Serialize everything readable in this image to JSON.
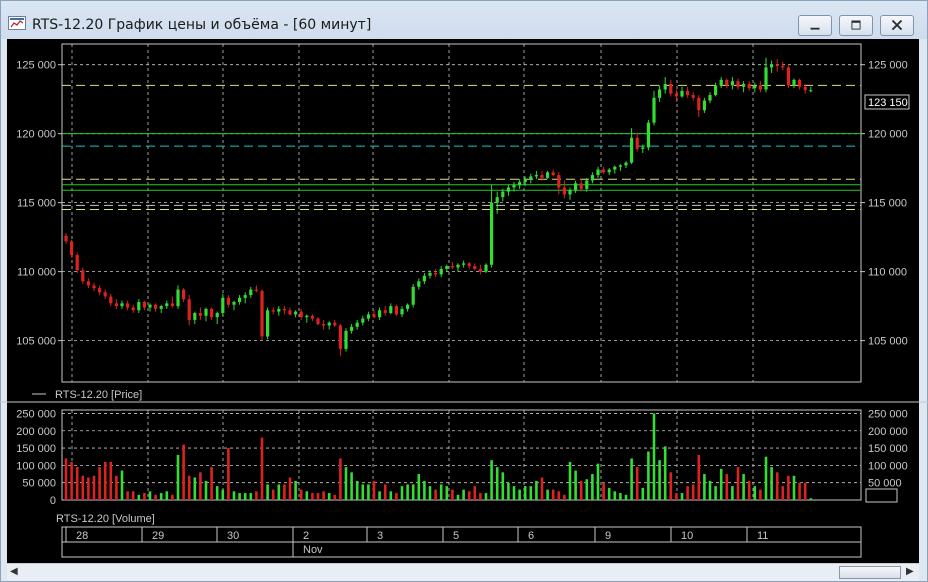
{
  "window": {
    "title": "RTS-12.20 График цены и объёма - [60 минут]",
    "buttons": [
      "minimize",
      "maximize",
      "close"
    ],
    "icon": "chart-window-icon"
  },
  "colors": {
    "background": "#000000",
    "up": "#33dd33",
    "down": "#dd2222",
    "grid": "#c8c8c8",
    "level_green": "#22cc22",
    "level_cyan": "#11c8c8",
    "level_yellow": "#e0e080",
    "level_white": "#c8c8c8",
    "price_label_bg": "#000000"
  },
  "price_panel": {
    "legend": "RTS-12.20 [Price]",
    "y_ticks": [
      "125 000",
      "120 000",
      "115 000",
      "110 000",
      "105 000"
    ],
    "current_price_label": "123 150"
  },
  "volume_panel": {
    "legend": "RTS-12.20 [Volume]",
    "y_ticks": [
      "250 000",
      "200 000",
      "150 000",
      "100 000",
      "50 000",
      "0"
    ]
  },
  "date_axis": {
    "days": [
      "28",
      "29",
      "30",
      "2",
      "3",
      "5",
      "6",
      "9",
      "10",
      "11"
    ],
    "month_label": "Nov"
  },
  "chart_data": {
    "type": "candlestick",
    "symbol": "RTS-12.20",
    "timeframe": "60 минут",
    "ylim_price": [
      102000,
      126500
    ],
    "ylim_volume": [
      0,
      260000
    ],
    "horizontal_levels": [
      {
        "price": 123500,
        "style": "dashed",
        "color": "yellow"
      },
      {
        "price": 120000,
        "style": "solid",
        "color": "green"
      },
      {
        "price": 119100,
        "style": "dashed",
        "color": "cyan"
      },
      {
        "price": 116700,
        "style": "dashed",
        "color": "yellow"
      },
      {
        "price": 116300,
        "style": "solid",
        "color": "green"
      },
      {
        "price": 115900,
        "style": "solid",
        "color": "green"
      },
      {
        "price": 114800,
        "style": "dashed",
        "color": "white"
      },
      {
        "price": 114500,
        "style": "dashed",
        "color": "yellow"
      }
    ],
    "candles": [
      [
        112600,
        112800,
        112000,
        112200
      ],
      [
        112200,
        112300,
        111000,
        111200
      ],
      [
        111200,
        111400,
        109900,
        110100
      ],
      [
        110100,
        110300,
        109100,
        109300
      ],
      [
        109300,
        109500,
        108800,
        109000
      ],
      [
        109000,
        109200,
        108600,
        108800
      ],
      [
        108800,
        109000,
        108300,
        108500
      ],
      [
        108500,
        108700,
        108000,
        108200
      ],
      [
        108200,
        108400,
        107500,
        107700
      ],
      [
        107700,
        108000,
        107300,
        107500
      ],
      [
        107500,
        107900,
        107300,
        107700
      ],
      [
        107700,
        107900,
        107200,
        107400
      ],
      [
        107400,
        107600,
        107000,
        107200
      ],
      [
        107200,
        108000,
        107000,
        107800
      ],
      [
        107800,
        107900,
        107200,
        107400
      ],
      [
        107400,
        107700,
        107100,
        107600
      ],
      [
        107600,
        107700,
        107100,
        107300
      ],
      [
        107300,
        107600,
        107000,
        107500
      ],
      [
        107500,
        107900,
        107300,
        107700
      ],
      [
        107700,
        108200,
        107400,
        107500
      ],
      [
        107500,
        109000,
        107300,
        108700
      ],
      [
        108700,
        108800,
        107800,
        108000
      ],
      [
        108000,
        108300,
        106100,
        106500
      ],
      [
        106500,
        107100,
        106200,
        107000
      ],
      [
        107000,
        107400,
        106500,
        106800
      ],
      [
        106800,
        107400,
        106400,
        107300
      ],
      [
        107300,
        107400,
        106500,
        106700
      ],
      [
        106700,
        107100,
        106200,
        107000
      ],
      [
        107000,
        108400,
        106800,
        108100
      ],
      [
        108100,
        108300,
        107400,
        107600
      ],
      [
        107600,
        107900,
        107200,
        107800
      ],
      [
        107800,
        108300,
        107600,
        108100
      ],
      [
        108100,
        108500,
        107700,
        108300
      ],
      [
        108300,
        108900,
        108100,
        108700
      ],
      [
        108700,
        109000,
        108500,
        108600
      ],
      [
        108600,
        108700,
        105000,
        105300
      ],
      [
        105300,
        107400,
        105100,
        107200
      ],
      [
        107200,
        107400,
        106900,
        107100
      ],
      [
        107100,
        107500,
        106800,
        107300
      ],
      [
        107300,
        107500,
        106900,
        107200
      ],
      [
        107200,
        107400,
        106800,
        106900
      ],
      [
        106900,
        107200,
        106700,
        107100
      ],
      [
        107100,
        107300,
        106500,
        106700
      ],
      [
        106700,
        106900,
        106300,
        106800
      ],
      [
        106800,
        106900,
        106400,
        106600
      ],
      [
        106600,
        106700,
        106100,
        106200
      ],
      [
        106200,
        106500,
        105800,
        106100
      ],
      [
        106100,
        106400,
        105800,
        106300
      ],
      [
        106300,
        106500,
        106000,
        106100
      ],
      [
        106100,
        106200,
        103900,
        104400
      ],
      [
        104400,
        105900,
        104200,
        105700
      ],
      [
        105700,
        106200,
        105500,
        106000
      ],
      [
        106000,
        106500,
        105800,
        106300
      ],
      [
        106300,
        106800,
        106100,
        106600
      ],
      [
        106600,
        107100,
        106400,
        106900
      ],
      [
        106900,
        107200,
        106600,
        106700
      ],
      [
        106700,
        107400,
        106500,
        107200
      ],
      [
        107200,
        107500,
        106800,
        107000
      ],
      [
        107000,
        107700,
        106900,
        107500
      ],
      [
        107500,
        107600,
        106800,
        106900
      ],
      [
        106900,
        107500,
        106700,
        107300
      ],
      [
        107300,
        107700,
        107100,
        107600
      ],
      [
        107600,
        109100,
        107400,
        108900
      ],
      [
        108900,
        109500,
        108700,
        109300
      ],
      [
        109300,
        109900,
        109100,
        109700
      ],
      [
        109700,
        110100,
        109500,
        109900
      ],
      [
        109900,
        110200,
        109600,
        109800
      ],
      [
        109800,
        110400,
        109600,
        110200
      ],
      [
        110200,
        110500,
        110000,
        110400
      ],
      [
        110400,
        110700,
        110200,
        110300
      ],
      [
        110300,
        110600,
        110000,
        110500
      ],
      [
        110500,
        110800,
        110300,
        110600
      ],
      [
        110600,
        110700,
        110200,
        110400
      ],
      [
        110400,
        110600,
        110100,
        110200
      ],
      [
        110200,
        110500,
        109800,
        110000
      ],
      [
        110000,
        110600,
        109900,
        110500
      ],
      [
        110500,
        116300,
        110300,
        115000
      ],
      [
        115000,
        115800,
        114200,
        115400
      ],
      [
        115400,
        116000,
        115100,
        115800
      ],
      [
        115800,
        116300,
        115500,
        116100
      ],
      [
        116100,
        116500,
        115800,
        116300
      ],
      [
        116300,
        116700,
        116000,
        116500
      ],
      [
        116500,
        116900,
        116200,
        116700
      ],
      [
        116700,
        117100,
        116400,
        116900
      ],
      [
        116900,
        117300,
        116700,
        117000
      ],
      [
        117000,
        117300,
        116600,
        116800
      ],
      [
        116800,
        117300,
        116700,
        117200
      ],
      [
        117200,
        117400,
        116900,
        117000
      ],
      [
        117000,
        117200,
        115600,
        116100
      ],
      [
        116100,
        116600,
        115300,
        115600
      ],
      [
        115600,
        116100,
        115200,
        115900
      ],
      [
        115900,
        116600,
        115700,
        116400
      ],
      [
        116400,
        116700,
        115800,
        116000
      ],
      [
        116000,
        116800,
        115800,
        116600
      ],
      [
        116600,
        117200,
        116400,
        117000
      ],
      [
        117000,
        117600,
        116800,
        117400
      ],
      [
        117400,
        117600,
        117100,
        117200
      ],
      [
        117200,
        117500,
        117000,
        117400
      ],
      [
        117400,
        117700,
        117100,
        117600
      ],
      [
        117600,
        117800,
        117300,
        117700
      ],
      [
        117700,
        118000,
        117500,
        117900
      ],
      [
        117900,
        120400,
        117800,
        119700
      ],
      [
        119700,
        120100,
        118700,
        118900
      ],
      [
        118900,
        119200,
        118600,
        119000
      ],
      [
        119000,
        121000,
        118800,
        120800
      ],
      [
        120800,
        123100,
        120600,
        122600
      ],
      [
        122600,
        123500,
        122300,
        123200
      ],
      [
        123200,
        124100,
        122900,
        123600
      ],
      [
        123600,
        123900,
        122700,
        122900
      ],
      [
        122900,
        123200,
        122300,
        122700
      ],
      [
        122700,
        123400,
        122600,
        123100
      ],
      [
        123100,
        123400,
        122600,
        122800
      ],
      [
        122800,
        123000,
        122400,
        122600
      ],
      [
        122600,
        122800,
        121200,
        121700
      ],
      [
        121700,
        122600,
        121500,
        122400
      ],
      [
        122400,
        123000,
        122200,
        122800
      ],
      [
        122800,
        123700,
        122700,
        123500
      ],
      [
        123500,
        124100,
        123300,
        123900
      ],
      [
        123900,
        124000,
        123300,
        123500
      ],
      [
        123500,
        124100,
        123200,
        123800
      ],
      [
        123800,
        124000,
        123200,
        123400
      ],
      [
        123400,
        123800,
        123000,
        123600
      ],
      [
        123600,
        123800,
        123100,
        123300
      ],
      [
        123300,
        123700,
        123000,
        123500
      ],
      [
        123500,
        123800,
        123000,
        123200
      ],
      [
        123200,
        125500,
        123000,
        124800
      ],
      [
        124800,
        125300,
        124400,
        125000
      ],
      [
        125000,
        125400,
        124500,
        124900
      ],
      [
        124900,
        125200,
        124600,
        124800
      ],
      [
        124800,
        125000,
        123300,
        123500
      ],
      [
        123500,
        124000,
        123300,
        123900
      ],
      [
        123900,
        124000,
        123200,
        123400
      ],
      [
        123400,
        123600,
        122900,
        123150
      ],
      [
        123150,
        123400,
        123000,
        123150
      ]
    ],
    "volumes": [
      120000,
      110000,
      95000,
      70000,
      65000,
      70000,
      95000,
      110000,
      110000,
      70000,
      85000,
      25000,
      25000,
      15000,
      20000,
      25000,
      15000,
      20000,
      25000,
      15000,
      130000,
      160000,
      70000,
      65000,
      80000,
      55000,
      95000,
      40000,
      30000,
      150000,
      25000,
      20000,
      20000,
      20000,
      25000,
      180000,
      45000,
      30000,
      45000,
      45000,
      65000,
      55000,
      30000,
      25000,
      20000,
      20000,
      25000,
      20000,
      15000,
      120000,
      95000,
      80000,
      55000,
      45000,
      45000,
      55000,
      25000,
      45000,
      25000,
      20000,
      40000,
      45000,
      45000,
      75000,
      55000,
      40000,
      30000,
      45000,
      40000,
      30000,
      15000,
      30000,
      25000,
      40000,
      20000,
      20000,
      115000,
      95000,
      80000,
      50000,
      40000,
      30000,
      40000,
      40000,
      55000,
      65000,
      30000,
      30000,
      25000,
      15000,
      110000,
      85000,
      55000,
      60000,
      75000,
      105000,
      50000,
      35000,
      25000,
      20000,
      15000,
      120000,
      95000,
      35000,
      140000,
      250000,
      115000,
      155000,
      80000,
      20000,
      20000,
      40000,
      45000,
      130000,
      75000,
      55000,
      40000,
      90000,
      75000,
      40000,
      95000,
      75000,
      55000,
      40000,
      30000,
      125000,
      95000,
      80000,
      40000,
      70000,
      70000,
      50000,
      50000,
      5000
    ],
    "candle_x_start": 66,
    "candle_x_step": 5.6
  }
}
